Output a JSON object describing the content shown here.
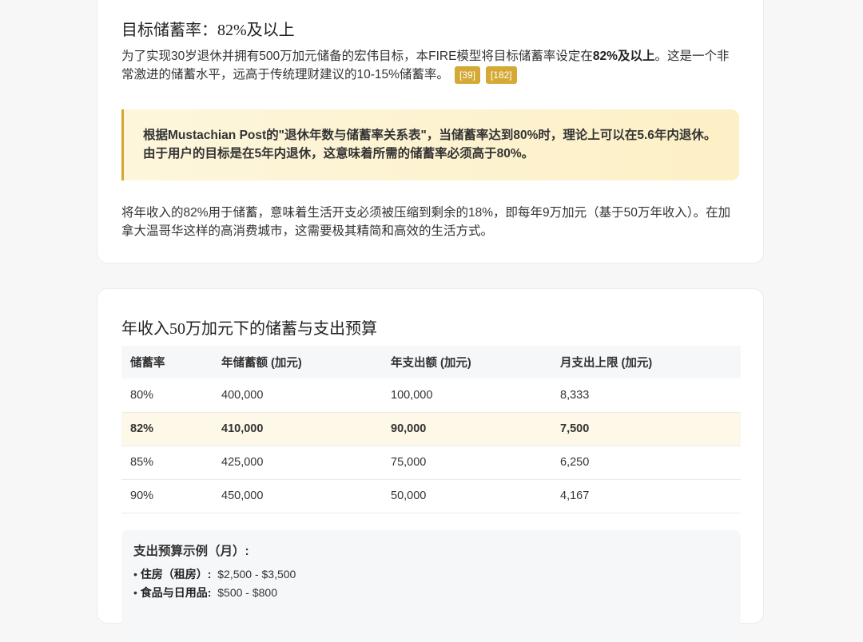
{
  "section1": {
    "heading": "目标储蓄率：82%及以上",
    "p1_a": "为了实现30岁退休并拥有500万加元储备的宏伟目标，本FIRE模型将目标储蓄率设定在",
    "p1_bold": "82%及以上",
    "p1_b": "。这是一个非常激进的储蓄水平，远高于传统理财建议的10-15%储蓄率。",
    "citations": [
      "[39]",
      "[182]"
    ],
    "quote": "根据Mustachian Post的\"退休年数与储蓄率关系表\"，当储蓄率达到80%时，理论上可以在5.6年内退休。由于用户的目标是在5年内退休，这意味着所需的储蓄率必须高于80%。",
    "p2": "将年收入的82%用于储蓄，意味着生活开支必须被压缩到剩余的18%，即每年9万加元（基于50万年收入）。在加拿大温哥华这样的高消费城市，这需要极其精简和高效的生活方式。"
  },
  "section2": {
    "heading": "年收入50万加元下的储蓄与支出预算",
    "columns": [
      "储蓄率",
      "年储蓄额 (加元)",
      "年支出额 (加元)",
      "月支出上限 (加元)"
    ],
    "rows": [
      [
        "80%",
        "400,000",
        "100,000",
        "8,333"
      ],
      [
        "82%",
        "410,000",
        "90,000",
        "7,500"
      ],
      [
        "85%",
        "425,000",
        "75,000",
        "6,250"
      ],
      [
        "90%",
        "450,000",
        "50,000",
        "4,167"
      ]
    ],
    "budget_title": "支出预算示例（月）:",
    "budget_items": [
      {
        "label": "住房（租房）:",
        "value": "$2,500 - $3,500"
      },
      {
        "label": "食品与日用品:",
        "value": "$500 - $800"
      }
    ]
  }
}
